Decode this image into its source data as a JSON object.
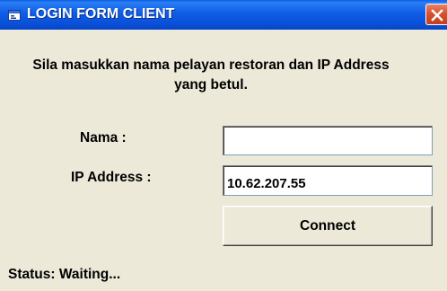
{
  "window": {
    "title": "LOGIN FORM CLIENT",
    "icon": "app-window-icon",
    "close_icon": "close-icon"
  },
  "form": {
    "message": "Sila masukkan nama pelayan restoran  dan IP Address yang betul.",
    "name_label": "Nama :",
    "name_value": "",
    "ip_label": "IP Address :",
    "ip_value": "10.62.207.55",
    "connect_label": "Connect"
  },
  "status": {
    "text": "Status: Waiting..."
  },
  "colors": {
    "titlebar": "#0a50d8",
    "dialog_background": "#ece9d8",
    "close_button": "#d7532f"
  }
}
